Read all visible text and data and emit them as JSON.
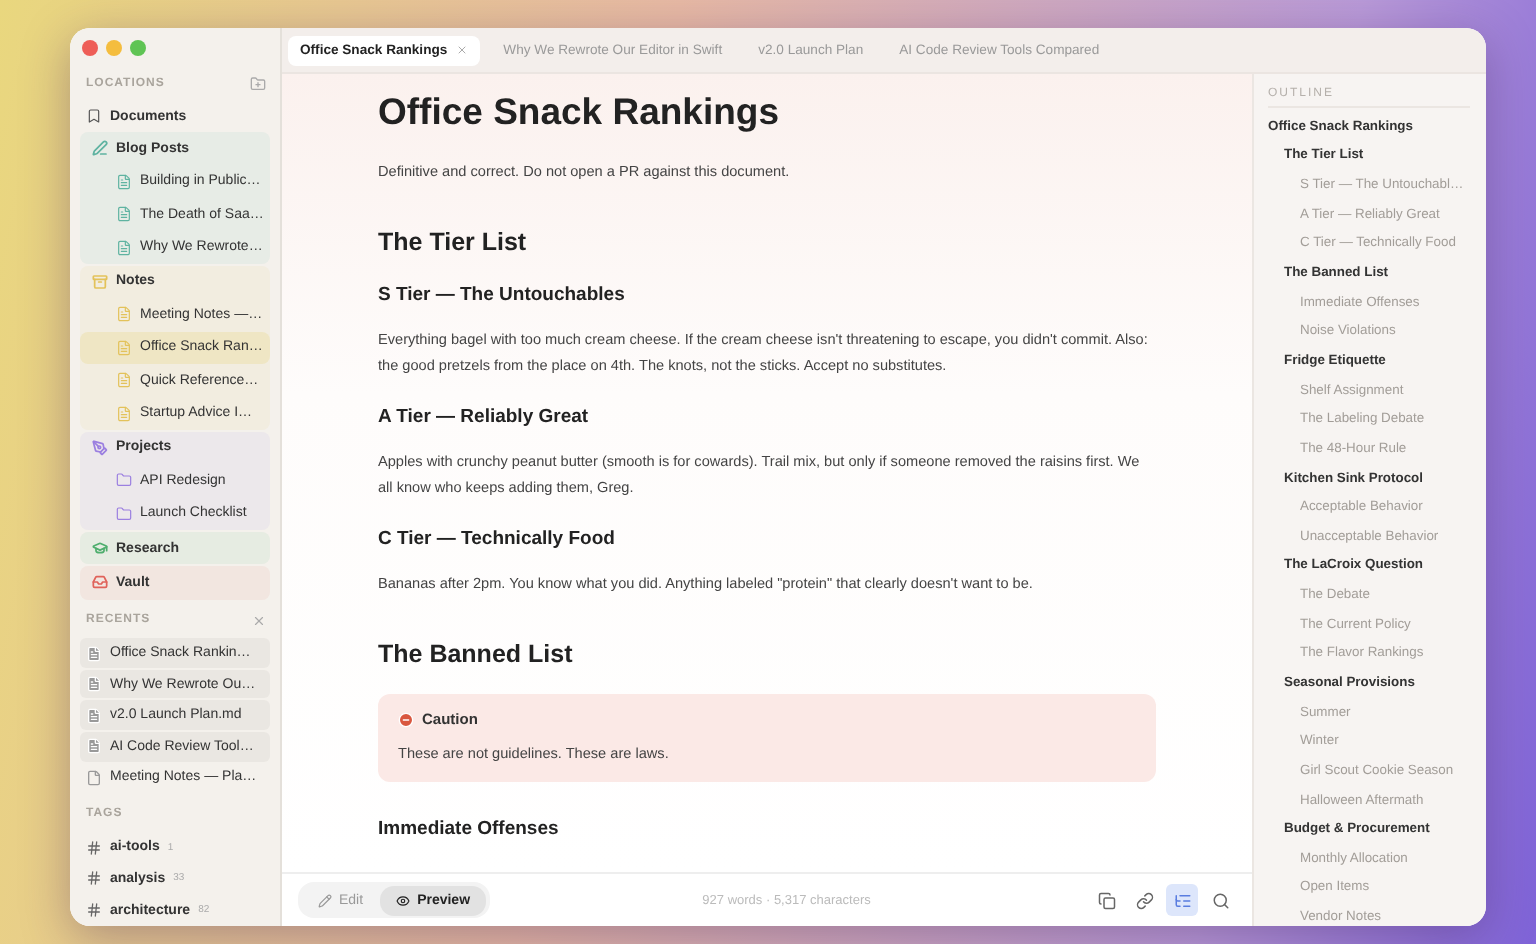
{
  "sidebar": {
    "locations": {
      "title": "LOCATIONS",
      "items": [
        {
          "label": "Documents",
          "kind": "bookmark",
          "selected": false
        },
        {
          "label": "Blog Posts",
          "kind": "blog",
          "color": "#5fb3a1",
          "selected": false,
          "children": [
            {
              "label": "Building in Public…",
              "kind": "file",
              "selected": false
            },
            {
              "label": "The Death of Saa…",
              "kind": "file",
              "selected": false
            },
            {
              "label": "Why We Rewrote…",
              "kind": "file",
              "selected": false
            }
          ]
        },
        {
          "label": "Notes",
          "kind": "notes",
          "color": "#e3c25a",
          "selected": false,
          "children": [
            {
              "label": "Meeting Notes —…",
              "kind": "file",
              "selected": false
            },
            {
              "label": "Office Snack Ran…",
              "kind": "file",
              "selected": true
            },
            {
              "label": "Quick Reference…",
              "kind": "file",
              "selected": false
            },
            {
              "label": "Startup Advice I…",
              "kind": "file",
              "selected": false
            }
          ]
        },
        {
          "label": "Projects",
          "kind": "projects",
          "color": "#9b7fe0",
          "selected": false,
          "children": [
            {
              "label": "API Redesign",
              "kind": "folder",
              "selected": false
            },
            {
              "label": "Launch Checklist",
              "kind": "folder",
              "selected": false
            }
          ]
        },
        {
          "label": "Research",
          "kind": "research",
          "color": "#4fae6e",
          "selected": false
        },
        {
          "label": "Vault",
          "kind": "vault",
          "color": "#e0625a",
          "selected": false
        }
      ]
    },
    "recents": {
      "title": "RECENTS",
      "items": [
        {
          "label": "Office Snack Rankin…",
          "open": true
        },
        {
          "label": "Why We Rewrote Ou…",
          "open": true
        },
        {
          "label": "v2.0 Launch Plan.md",
          "open": true
        },
        {
          "label": "AI Code Review Tool…",
          "open": true
        },
        {
          "label": "Meeting Notes — Pla…",
          "open": false
        }
      ]
    },
    "tags": {
      "title": "TAGS",
      "items": [
        {
          "label": "ai-tools",
          "count": "1"
        },
        {
          "label": "analysis",
          "count": "33"
        },
        {
          "label": "architecture",
          "count": "82"
        }
      ]
    }
  },
  "tabs": [
    {
      "label": "Office Snack Rankings",
      "selected": true
    },
    {
      "label": "Why We Rewrote Our Editor in Swift",
      "selected": false
    },
    {
      "label": "v2.0 Launch Plan",
      "selected": false
    },
    {
      "label": "AI Code Review Tools Compared",
      "selected": false
    }
  ],
  "document": [
    {
      "kind": "h1",
      "text": "Office Snack Rankings"
    },
    {
      "kind": "p",
      "text": "Definitive and correct. Do not open a PR against this document."
    },
    {
      "kind": "h2",
      "text": "The Tier List"
    },
    {
      "kind": "h3",
      "text": "S Tier — The Untouchables"
    },
    {
      "kind": "p",
      "text": "Everything bagel with too much cream cheese. If the cream cheese isn't threatening to escape, you didn't commit. Also: the good pretzels from the place on 4th. The knots, not the sticks. Accept no substitutes."
    },
    {
      "kind": "h3",
      "text": "A Tier — Reliably Great"
    },
    {
      "kind": "p",
      "text": "Apples with crunchy peanut butter (smooth is for cowards). Trail mix, but only if someone removed the raisins first. We all know who keeps adding them, Greg."
    },
    {
      "kind": "h3",
      "text": "C Tier — Technically Food"
    },
    {
      "kind": "p",
      "text": "Bananas after 2pm. You know what you did. Anything labeled \"protein\" that clearly doesn't want to be."
    },
    {
      "kind": "h2",
      "text": "The Banned List"
    },
    {
      "kind": "callout",
      "title": "Caution",
      "text": "These are not guidelines. These are laws."
    },
    {
      "kind": "h3",
      "text": "Immediate Offenses"
    }
  ],
  "bottom_bar": {
    "modes": [
      {
        "label": "Edit",
        "kind": "edit",
        "selected": false
      },
      {
        "label": "Preview",
        "kind": "preview",
        "selected": true
      }
    ],
    "stats": "927 words · 5,317 characters",
    "tools": [
      {
        "kind": "copy",
        "selected": false
      },
      {
        "kind": "link",
        "selected": false
      },
      {
        "kind": "outline",
        "selected": true
      },
      {
        "kind": "search",
        "selected": false
      }
    ]
  },
  "outline": {
    "title": "OUTLINE",
    "items": [
      {
        "label": "Office Snack Rankings",
        "children": [
          {
            "label": "The Tier List",
            "children": [
              {
                "label": "S Tier — The Untouchabl…"
              },
              {
                "label": "A Tier — Reliably Great"
              },
              {
                "label": "C Tier — Technically Food"
              }
            ]
          },
          {
            "label": "The Banned List",
            "children": [
              {
                "label": "Immediate Offenses"
              },
              {
                "label": "Noise Violations"
              }
            ]
          },
          {
            "label": "Fridge Etiquette",
            "children": [
              {
                "label": "Shelf Assignment"
              },
              {
                "label": "The Labeling Debate"
              },
              {
                "label": "The 48-Hour Rule"
              }
            ]
          },
          {
            "label": "Kitchen Sink Protocol",
            "children": [
              {
                "label": "Acceptable Behavior"
              },
              {
                "label": "Unacceptable Behavior"
              }
            ]
          },
          {
            "label": "The LaCroix Question",
            "children": [
              {
                "label": "The Debate"
              },
              {
                "label": "The Current Policy"
              },
              {
                "label": "The Flavor Rankings"
              }
            ]
          },
          {
            "label": "Seasonal Provisions",
            "children": [
              {
                "label": "Summer"
              },
              {
                "label": "Winter"
              },
              {
                "label": "Girl Scout Cookie Season"
              },
              {
                "label": "Halloween Aftermath"
              }
            ]
          },
          {
            "label": "Budget & Procurement",
            "children": [
              {
                "label": "Monthly Allocation"
              },
              {
                "label": "Open Items"
              },
              {
                "label": "Vendor Notes"
              }
            ]
          }
        ]
      }
    ]
  }
}
